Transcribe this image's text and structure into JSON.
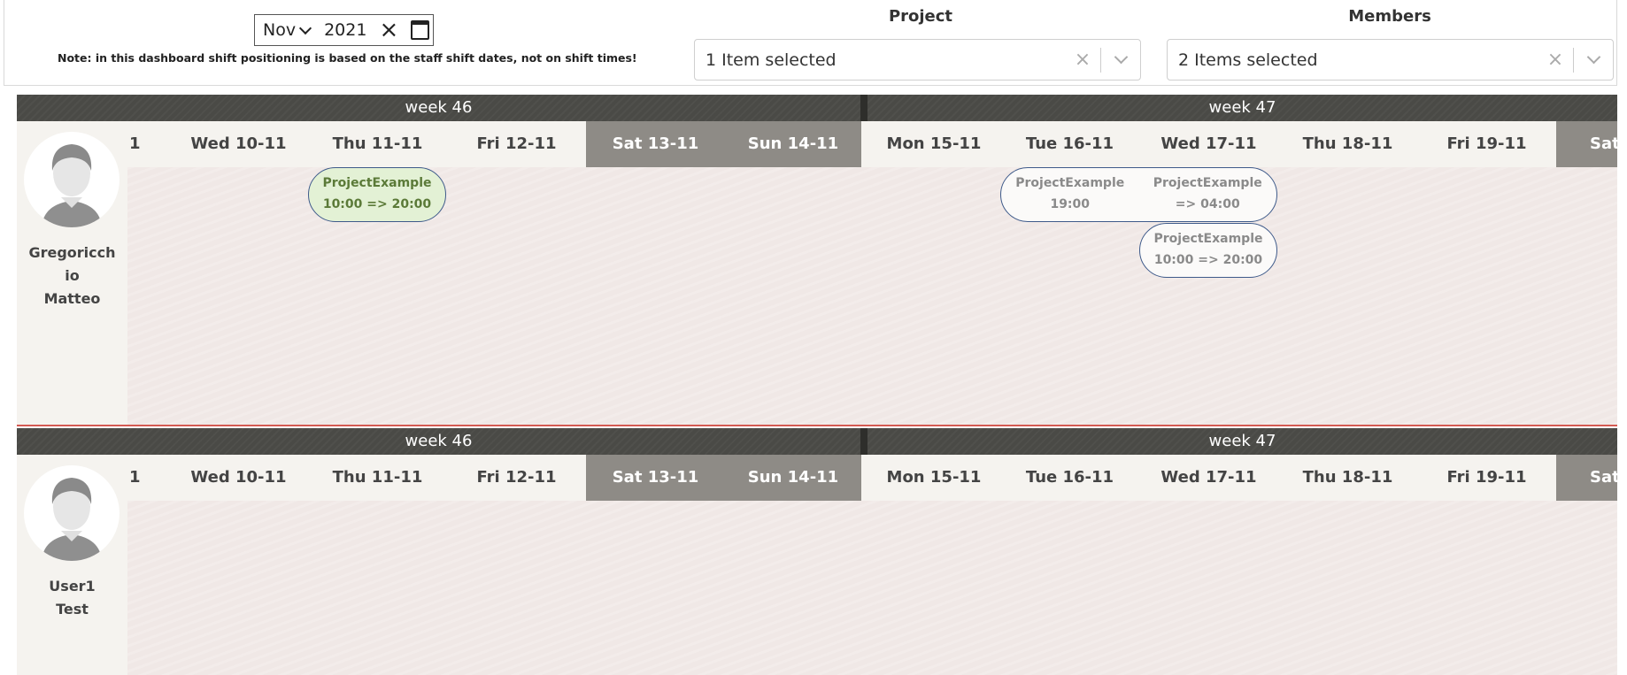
{
  "filters": {
    "month": "Nov",
    "year": "2021",
    "clear_symbol": "×",
    "note": "Note: in this dashboard shift positioning is based on the staff shift dates, not on shift times!",
    "project": {
      "title": "Project",
      "value": "1 Item selected"
    },
    "members": {
      "title": "Members",
      "value": "2 Items selected"
    }
  },
  "weeks": [
    "week 46",
    "week 47"
  ],
  "days": [
    {
      "label": "1",
      "weekend": false
    },
    {
      "label": "Wed 10-11",
      "weekend": false
    },
    {
      "label": "Thu 11-11",
      "weekend": false
    },
    {
      "label": "Fri 12-11",
      "weekend": false
    },
    {
      "label": "Sat 13-11",
      "weekend": true
    },
    {
      "label": "Sun 14-11",
      "weekend": true
    },
    {
      "label": "Mon 15-11",
      "weekend": false
    },
    {
      "label": "Tue 16-11",
      "weekend": false
    },
    {
      "label": "Wed 17-11",
      "weekend": false
    },
    {
      "label": "Thu 18-11",
      "weekend": false
    },
    {
      "label": "Fri 19-11",
      "weekend": false
    },
    {
      "label": "Sat",
      "weekend": true
    }
  ],
  "members": [
    {
      "name_lines": [
        "Gregoricch",
        "io",
        "Matteo"
      ],
      "shifts": [
        {
          "project": "ProjectExample",
          "time": "10:00 => 20:00",
          "style": "green"
        },
        {
          "project": "ProjectExample",
          "time": "19:00",
          "time2": "=> 04:00",
          "style": "white"
        },
        {
          "project": "ProjectExample",
          "time": "10:00 => 20:00",
          "style": "white"
        }
      ]
    },
    {
      "name_lines": [
        "User1",
        "Test"
      ],
      "shifts": []
    }
  ],
  "colors": {
    "week_bar": "#4a4a46",
    "weekend_header": "#8e8b86",
    "grid": "#f0e8e6",
    "shift_green": "#e3f1d5",
    "shift_border": "#3e5a8a",
    "row_separator": "#d45a52"
  }
}
